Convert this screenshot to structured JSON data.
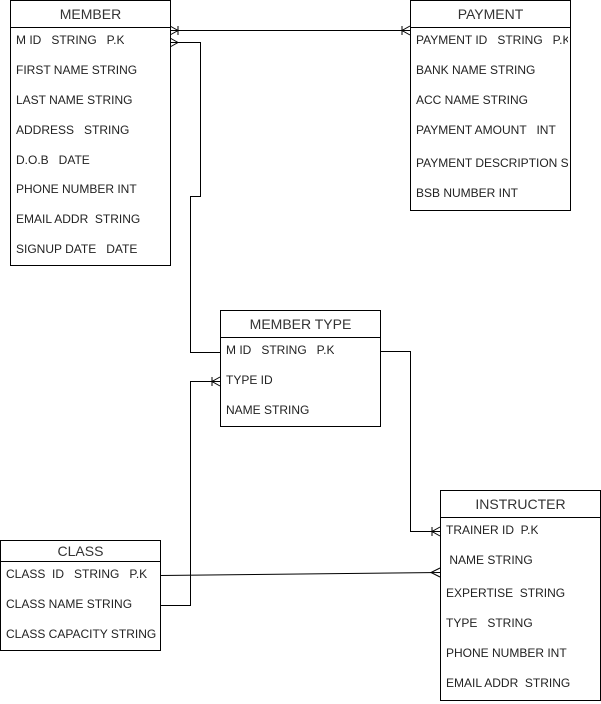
{
  "entities": {
    "member": {
      "title": "MEMBER",
      "fields": [
        "M ID   STRING   P.K",
        "FIRST NAME STRING",
        "LAST NAME STRING",
        "ADDRESS   STRING",
        "D.O.B   DATE",
        "PHONE NUMBER INT",
        "EMAIL ADDR  STRING",
        "SIGNUP DATE   DATE"
      ]
    },
    "payment": {
      "title": "PAYMENT",
      "fields": [
        "PAYMENT ID   STRING   P.K",
        "BANK NAME STRING",
        "ACC NAME STRING",
        "PAYMENT AMOUNT   INT",
        "PAYMENT DESCRIPTION STRING",
        "BSB NUMBER INT"
      ]
    },
    "member_type": {
      "title": "MEMBER TYPE",
      "fields": [
        "M ID   STRING   P.K",
        "TYPE ID",
        "NAME STRING"
      ]
    },
    "class": {
      "title": "CLASS",
      "fields": [
        "CLASS  ID   STRING   P.K",
        "CLASS NAME STRING",
        "CLASS CAPACITY STRING"
      ]
    },
    "instructer": {
      "title": "INSTRUCTER",
      "fields": [
        "TRAINER ID  P.K",
        " NAME STRING",
        "EXPERTISE  STRING",
        "TYPE   STRING",
        "PHONE NUMBER INT",
        "EMAIL ADDR  STRING"
      ]
    }
  },
  "relationships": [
    {
      "from": "MEMBER",
      "to": "PAYMENT",
      "from_end": "one-or-many",
      "to_end": "one-or-many"
    },
    {
      "from": "MEMBER",
      "to": "MEMBER TYPE",
      "from_end": "many",
      "to_end": "none"
    },
    {
      "from": "MEMBER TYPE",
      "to": "INSTRUCTER",
      "from_end": "none",
      "to_end": "one-or-many"
    },
    {
      "from": "CLASS",
      "to": "MEMBER TYPE",
      "from_end": "none",
      "to_end": "one-or-many"
    },
    {
      "from": "CLASS",
      "to": "INSTRUCTER",
      "from_end": "none",
      "to_end": "many"
    }
  ]
}
